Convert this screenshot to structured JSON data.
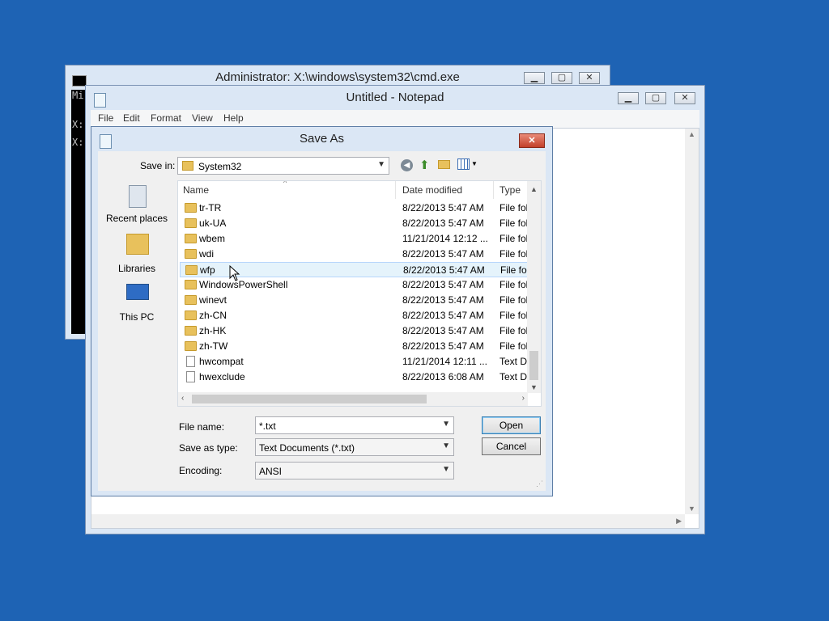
{
  "cmd": {
    "title": "Administrator: X:\\windows\\system32\\cmd.exe",
    "icon_text": "C:\\.",
    "lines": [
      "Mi",
      "X:",
      "X:"
    ]
  },
  "notepad": {
    "title": "Untitled - Notepad",
    "menu": [
      "File",
      "Edit",
      "Format",
      "View",
      "Help"
    ]
  },
  "dialog": {
    "title": "Save As",
    "save_in_label": "Save in:",
    "save_in_value": "System32",
    "places": [
      {
        "label": "Recent places",
        "icon": "recent-places-icon"
      },
      {
        "label": "Libraries",
        "icon": "libraries-icon"
      },
      {
        "label": "This PC",
        "icon": "this-pc-icon"
      }
    ],
    "columns": [
      "Name",
      "Date modified",
      "Type"
    ],
    "files": [
      {
        "name": "tr-TR",
        "date": "8/22/2013 5:47 AM",
        "type": "File fol",
        "kind": "folder"
      },
      {
        "name": "uk-UA",
        "date": "8/22/2013 5:47 AM",
        "type": "File fol",
        "kind": "folder"
      },
      {
        "name": "wbem",
        "date": "11/21/2014 12:12 ...",
        "type": "File fol",
        "kind": "folder"
      },
      {
        "name": "wdi",
        "date": "8/22/2013 5:47 AM",
        "type": "File fol",
        "kind": "folder"
      },
      {
        "name": "wfp",
        "date": "8/22/2013 5:47 AM",
        "type": "File fol",
        "kind": "folder"
      },
      {
        "name": "WindowsPowerShell",
        "date": "8/22/2013 5:47 AM",
        "type": "File fol",
        "kind": "folder"
      },
      {
        "name": "winevt",
        "date": "8/22/2013 5:47 AM",
        "type": "File fol",
        "kind": "folder"
      },
      {
        "name": "zh-CN",
        "date": "8/22/2013 5:47 AM",
        "type": "File fol",
        "kind": "folder"
      },
      {
        "name": "zh-HK",
        "date": "8/22/2013 5:47 AM",
        "type": "File fol",
        "kind": "folder"
      },
      {
        "name": "zh-TW",
        "date": "8/22/2013 5:47 AM",
        "type": "File fol",
        "kind": "folder"
      },
      {
        "name": "hwcompat",
        "date": "11/21/2014 12:11 ...",
        "type": "Text Do",
        "kind": "file"
      },
      {
        "name": "hwexclude",
        "date": "8/22/2013 6:08 AM",
        "type": "Text Do",
        "kind": "file"
      }
    ],
    "file_name_label": "File name:",
    "file_name_value": "*.txt",
    "save_type_label": "Save as type:",
    "save_type_value": "Text Documents (*.txt)",
    "encoding_label": "Encoding:",
    "encoding_value": "ANSI",
    "open_label": "Open",
    "cancel_label": "Cancel"
  },
  "colors": {
    "desktop": "#1e63b4",
    "folder": "#e8c15c",
    "close": "#c2402a"
  }
}
